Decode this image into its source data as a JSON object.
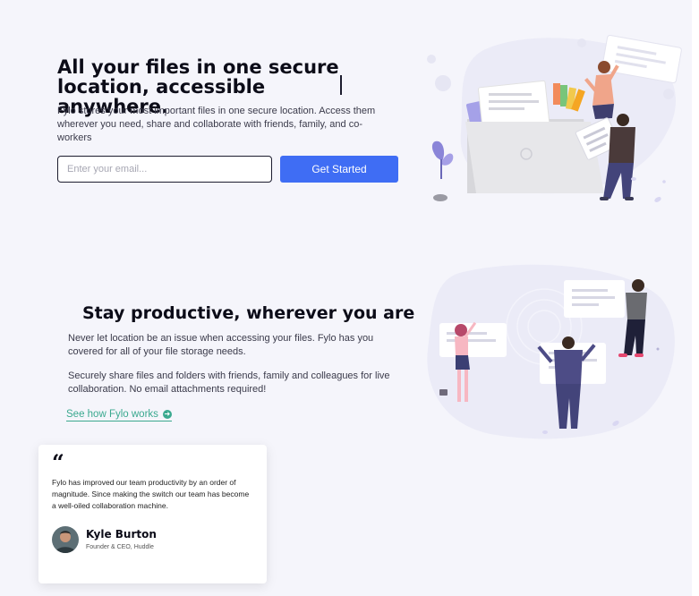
{
  "hero": {
    "title": "All your files in one secure location, accessible anywhere.",
    "description": "Fylo stores your most important files in one secure location. Access them wherever you need, share and collaborate with friends, family, and co-workers",
    "email_placeholder": "Enter your email...",
    "cta_label": "Get Started"
  },
  "productive": {
    "title": "Stay productive, wherever you are",
    "paragraph1": "Never let location be an issue when accessing your files. Fylo has you covered for all of your file storage needs.",
    "paragraph2": "Securely share files and folders with friends, family and colleagues for live collaboration. No email attachments required!",
    "link_label": "See how Fylo works",
    "link_icon": "arrow-right-circle-icon"
  },
  "testimonial": {
    "quote_icon": "quote-icon",
    "quote_mark": "“",
    "quote": "Fylo has improved our team productivity by an order of magnitude. Since making the switch our team has become a well-oiled collaboration machine.",
    "name": "Kyle Burton",
    "role": "Founder & CEO, Huddle"
  },
  "colors": {
    "accent_blue": "#3f6df4",
    "accent_teal": "#3ba98f",
    "background": "#f5f5fb"
  }
}
